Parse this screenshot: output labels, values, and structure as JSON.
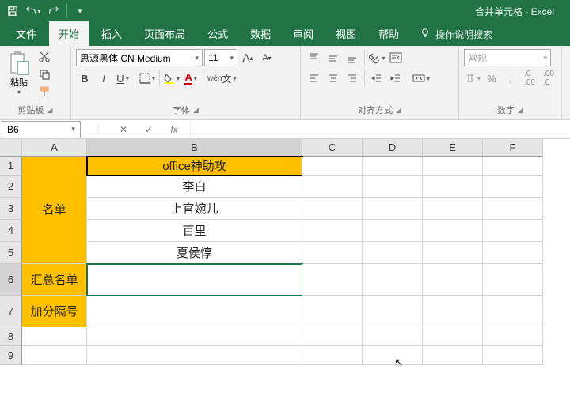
{
  "title": "合并单元格 - Excel",
  "tabs": {
    "file": "文件",
    "home": "开始",
    "insert": "插入",
    "layout": "页面布局",
    "formulas": "公式",
    "data": "数据",
    "review": "审阅",
    "view": "视图",
    "help": "帮助",
    "tellme": "操作说明搜索"
  },
  "ribbon": {
    "clipboard": {
      "label": "剪贴板",
      "paste": "粘贴"
    },
    "font": {
      "label": "字体",
      "name": "思源黑体 CN Medium",
      "size": "11",
      "bold": "B",
      "italic": "I",
      "underline": "U"
    },
    "align": {
      "label": "对齐方式"
    },
    "number": {
      "label": "数字",
      "format": "常规"
    }
  },
  "namebox": "B6",
  "columns": [
    "A",
    "B",
    "C",
    "D",
    "E",
    "F"
  ],
  "rows": [
    "1",
    "2",
    "3",
    "4",
    "5",
    "6",
    "7",
    "8",
    "9"
  ],
  "cells": {
    "A_merge_1_5": "名单",
    "A6": "汇总名单",
    "A7": "加分隔号",
    "B1": "office神助攻",
    "B2": "李白",
    "B3": "上官婉儿",
    "B4": "百里",
    "B5": "夏侯惇"
  }
}
